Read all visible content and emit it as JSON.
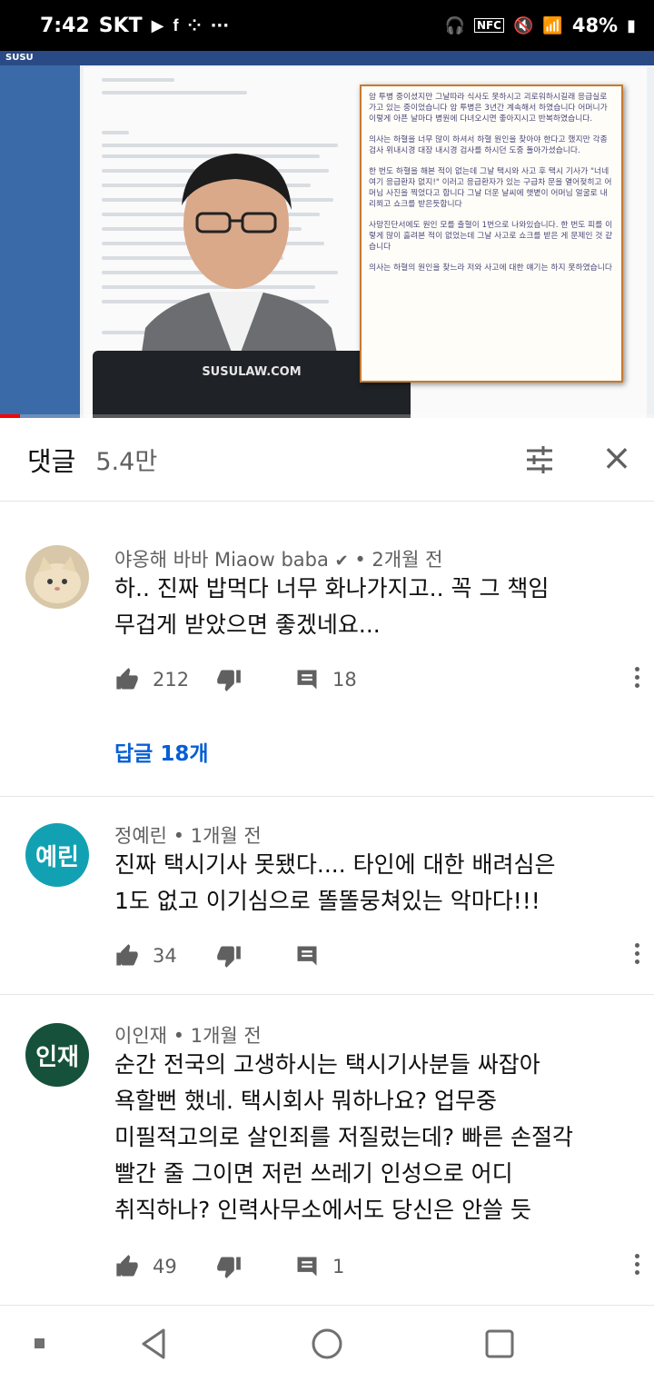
{
  "status_bar": {
    "time": "7:42",
    "carrier": "SKT",
    "battery": "48%",
    "more": "···"
  },
  "video": {
    "brand": "SUSU",
    "laptop_label": "SUSULAW.COM",
    "quote_paragraphs": [
      "암 투병 중이셨지만 그날따라 식사도 못하시고 괴로워하시길래 응급실로 가고 있는 중이었습니다 암 투병은 3년간 계속해서 하였습니다 어머니가 이렇게 아픈 날마다 병원에 다녀오시면 좋아지시고 반복하였습니다.",
      "의사는 하혈을 너무 많이 하셔서 하혈 원인을 찾아야 한다고 했지만 각종 검사 위내시경 대장 내시경 검사를 하시던 도중 돌아가셨습니다.",
      "한 번도 하혈을 해본 적이 없는데 그날 택시와 사고 후 택시 기사가 \"너네 여기 응급환자 없지!\" 이러고 응급환자가 있는 구급차 문을 열어젖히고 어머님 사진을 찍었다고 합니다 그날 더운 날씨에 햇볕이 어머님 얼굴로 내리쬐고 쇼크를 받은듯합니다",
      "사망진단서에도 원인 모를 출혈이 1번으로 나와있습니다. 한 번도 피를 이렇게 많이 흘려본 적이 없었는데 그날 사고로 쇼크를 받은 게 문제인 것 같습니다",
      "의사는 하혈의 원인을 찾느라 저와 사고에 대한 얘기는 하지 못하였습니다"
    ],
    "progress_fraction": 0.03
  },
  "comments_header": {
    "title": "댓글",
    "count": "5.4만"
  },
  "comments": [
    {
      "author": "야옹해 바바 Miaow baba",
      "verified": true,
      "time": "2개월 전",
      "text": "하.. 진짜 밥먹다 너무 화나가지고.. 꼭 그 책임\n무겁게 받았으면 좋겠네요...",
      "likes": "212",
      "replies_count": "18",
      "replies_link": "답글 18개",
      "avatar_text": "",
      "avatar_color": "#d8c7a8"
    },
    {
      "author": "정예린",
      "verified": false,
      "time": "1개월 전",
      "text": "진짜  택시기사  못됐다....  타인에 대한 배려심은\n1도 없고  이기심으로 똘똘뭉쳐있는  악마다!!!",
      "likes": "34",
      "replies_count": "",
      "avatar_text": "예린",
      "avatar_color": "#12a1b3"
    },
    {
      "author": "이인재",
      "verified": false,
      "time": "1개월 전",
      "text": "순간 전국의 고생하시는 택시기사분들 싸잡아\n욕할뻔 했네.  택시회사 뭐하나요?  업무중\n미필적고의로 살인죄를 저질렀는데? 빠른 손절각\n빨간 줄 그이면 저런 쓰레기 인성으로 어디\n취직하나?  인력사무소에서도 당신은 안쓸 듯",
      "likes": "49",
      "replies_count": "1",
      "avatar_text": "인재",
      "avatar_color": "#15513b"
    }
  ]
}
